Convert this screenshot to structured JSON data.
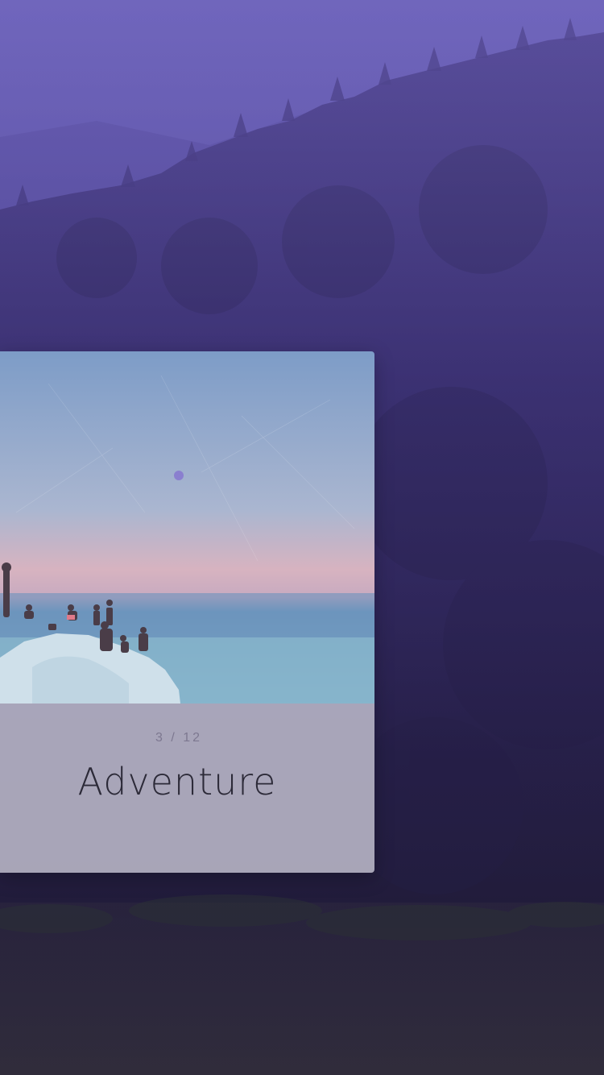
{
  "card": {
    "counter": "3 / 12",
    "title": "Adventure",
    "photo_alt": "group of people sitting on white rocks at the seaside at dusk"
  },
  "colors": {
    "overlay_top": "#6f66b8",
    "overlay_bottom": "#241d3a",
    "footer": "#bdbbcb",
    "indicator": "#8a7fcf",
    "title_text": "#2c2a38",
    "counter_text": "#7d7890"
  },
  "icons": {
    "page_indicator": "page-indicator-dot-icon"
  }
}
